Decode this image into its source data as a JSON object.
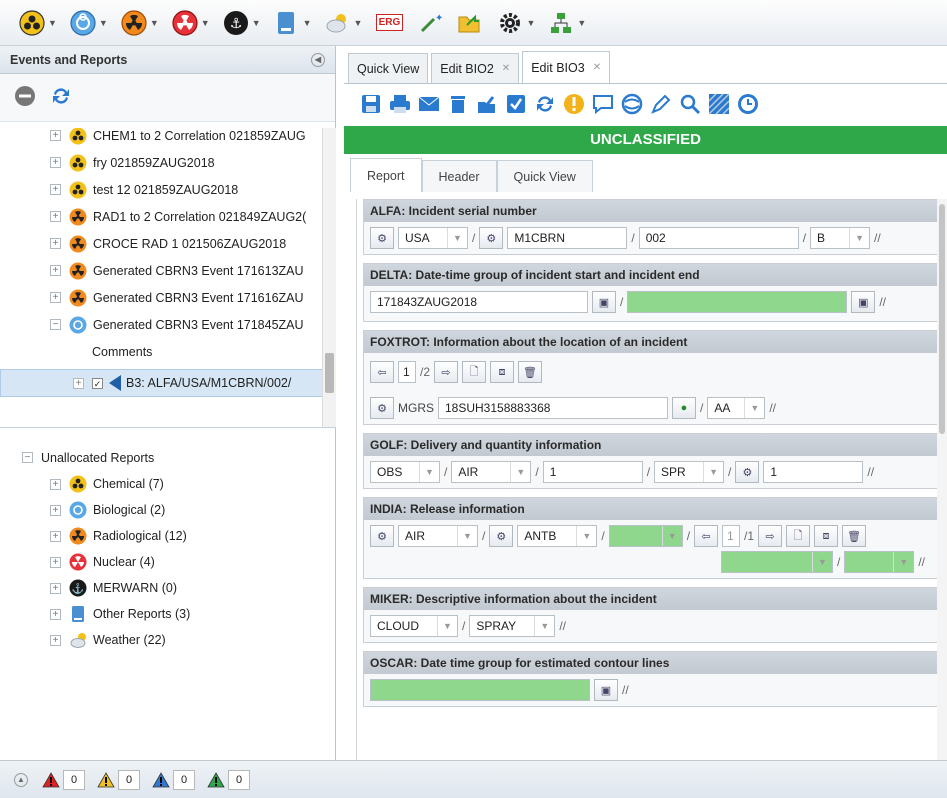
{
  "toolbar": {
    "icons": [
      "chemical-icon",
      "biological-icon",
      "radiological-icon",
      "nuclear-icon",
      "merwarn-icon",
      "other-reports-icon",
      "weather-icon",
      "erg-icon",
      "wand-icon",
      "folder-icon",
      "gear-icon",
      "network-icon"
    ],
    "erg_label": "ERG"
  },
  "left_panel": {
    "title": "Events and Reports",
    "events": [
      {
        "label": "CHEM1 to 2 Correlation 021859ZAUG",
        "type": "chemical",
        "expander": "+"
      },
      {
        "label": "fry 021859ZAUG2018",
        "type": "chemical",
        "expander": "+"
      },
      {
        "label": "test 12 021859ZAUG2018",
        "type": "chemical",
        "expander": "+"
      },
      {
        "label": "RAD1 to 2 Correlation 021849ZAUG2(",
        "type": "radiological",
        "expander": "+"
      },
      {
        "label": "CROCE RAD 1 021506ZAUG2018",
        "type": "radiological",
        "expander": "+"
      },
      {
        "label": "Generated CBRN3 Event 171613ZAU",
        "type": "radiological",
        "expander": "+"
      },
      {
        "label": "Generated CBRN3 Event 171616ZAU",
        "type": "radiological",
        "expander": "+"
      },
      {
        "label": "Generated CBRN3 Event 171845ZAU",
        "type": "biological",
        "expander": "−"
      }
    ],
    "comments_label": "Comments",
    "selected_report": "B3: ALFA/USA/M1CBRN/002/",
    "unallocated_title": "Unallocated Reports",
    "unallocated": [
      {
        "label": "Chemical (7)",
        "type": "chemical"
      },
      {
        "label": "Biological (2)",
        "type": "biological"
      },
      {
        "label": "Radiological (12)",
        "type": "radiological"
      },
      {
        "label": "Nuclear (4)",
        "type": "nuclear"
      },
      {
        "label": "MERWARN (0)",
        "type": "merwarn"
      },
      {
        "label": "Other Reports (3)",
        "type": "other"
      },
      {
        "label": "Weather (22)",
        "type": "weather"
      }
    ]
  },
  "status": {
    "counters": [
      {
        "color": "#e02020",
        "value": "0"
      },
      {
        "color": "#f0c020",
        "value": "0"
      },
      {
        "color": "#2f7ad0",
        "value": "0"
      },
      {
        "color": "#2fa84a",
        "value": "0"
      }
    ]
  },
  "tabs": [
    {
      "label": "Quick View",
      "closable": false
    },
    {
      "label": "Edit BIO2",
      "closable": true
    },
    {
      "label": "Edit BIO3",
      "closable": true,
      "active": true
    }
  ],
  "tab_close": "✕",
  "classification": "UNCLASSIFIED",
  "subtabs": [
    "Report",
    "Header",
    "Quick View"
  ],
  "sections": {
    "alfa": {
      "title": "ALFA: Incident serial number",
      "country": "USA",
      "unit": "M1CBRN",
      "serial": "002",
      "letter": "B"
    },
    "delta": {
      "title": "DELTA: Date-time group of incident start and incident end",
      "start": "171843ZAUG2018",
      "end": ""
    },
    "foxtrot": {
      "title": "FOXTROT: Information about the location of an incident",
      "page": "1",
      "of": "/2",
      "grid_label": "MGRS",
      "location": "18SUH3158883368",
      "accuracy": "AA"
    },
    "golf": {
      "title": "GOLF: Delivery and quantity information",
      "obs": "OBS",
      "means": "AIR",
      "qty": "1",
      "type": "SPR",
      "num": "1"
    },
    "india": {
      "title": "INDIA: Release information",
      "height": "AIR",
      "type": "ANTB",
      "page": "1",
      "of": "/1"
    },
    "miker": {
      "title": "MIKER: Descriptive information about the incident",
      "desc": "CLOUD",
      "kind": "SPRAY"
    },
    "oscar": {
      "title": "OSCAR: Date time group for estimated contour lines"
    }
  },
  "sep": {
    "slash": "/",
    "dslash": "//"
  }
}
